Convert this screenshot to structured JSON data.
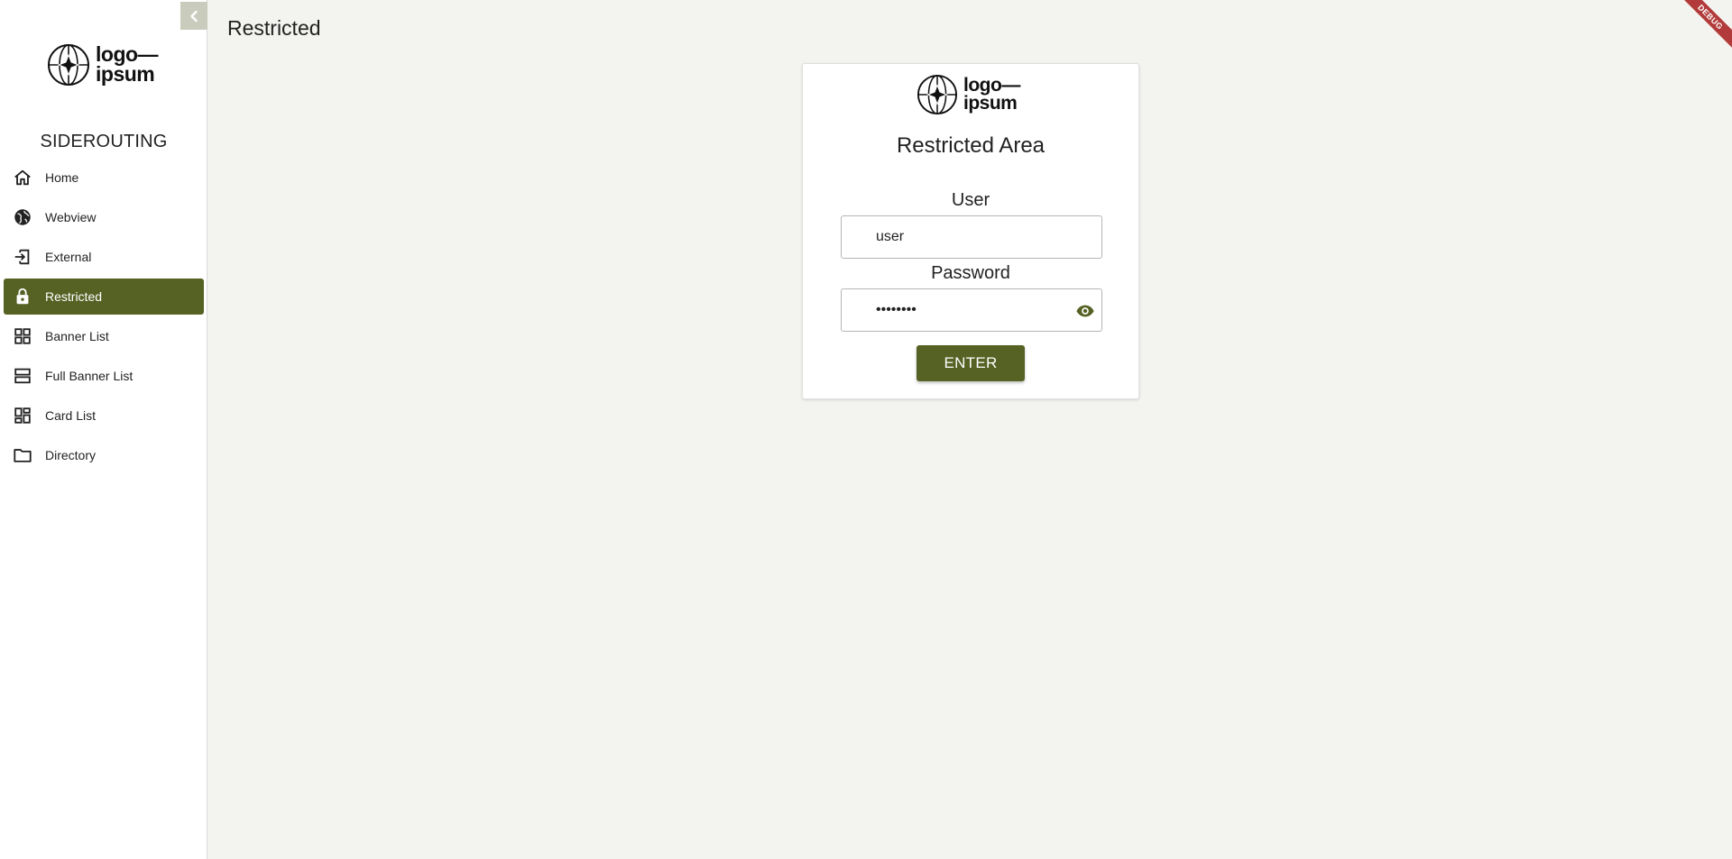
{
  "sidebar": {
    "logo": {
      "line1": "logo—",
      "line2": "ipsum"
    },
    "app_title": "SIDEROUTING",
    "items": [
      {
        "label": "Home",
        "icon": "home-icon",
        "active": false
      },
      {
        "label": "Webview",
        "icon": "globe-icon",
        "active": false
      },
      {
        "label": "External",
        "icon": "external-login-icon",
        "active": false
      },
      {
        "label": "Restricted",
        "icon": "lock-icon",
        "active": true
      },
      {
        "label": "Banner List",
        "icon": "grid-icon",
        "active": false
      },
      {
        "label": "Full Banner List",
        "icon": "rows-icon",
        "active": false
      },
      {
        "label": "Card List",
        "icon": "dashboard-icon",
        "active": false
      },
      {
        "label": "Directory",
        "icon": "folder-icon",
        "active": false
      }
    ]
  },
  "header": {
    "title": "Restricted"
  },
  "login": {
    "logo": {
      "line1": "logo—",
      "line2": "ipsum"
    },
    "title": "Restricted Area",
    "user_label": "User",
    "user_value": "user",
    "password_label": "Password",
    "password_value": "password",
    "enter_label": "ENTER"
  },
  "debug_banner": "DEBUG",
  "colors": {
    "accent": "#556224",
    "background": "#f3f3ef",
    "ribbon": "#b23a3a"
  }
}
